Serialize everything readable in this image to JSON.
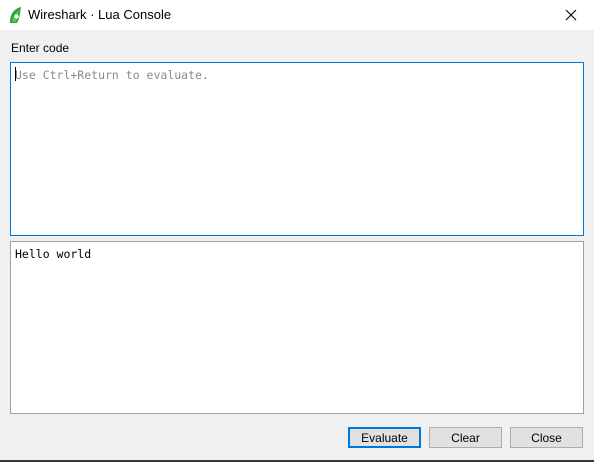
{
  "window": {
    "title": "Wireshark · Lua Console",
    "icon": "wireshark-fin-icon",
    "close_icon": "close-icon"
  },
  "editor": {
    "label": "Enter code",
    "value": "",
    "placeholder": "Use Ctrl+Return to evaluate."
  },
  "output": {
    "text": "Hello world"
  },
  "buttons": {
    "evaluate": "Evaluate",
    "clear": "Clear",
    "close": "Close"
  },
  "colors": {
    "accent": "#0078d7",
    "icon_green": "#2fa52f",
    "button_face": "#e1e1e1",
    "window_bg": "#f0f0f0"
  }
}
